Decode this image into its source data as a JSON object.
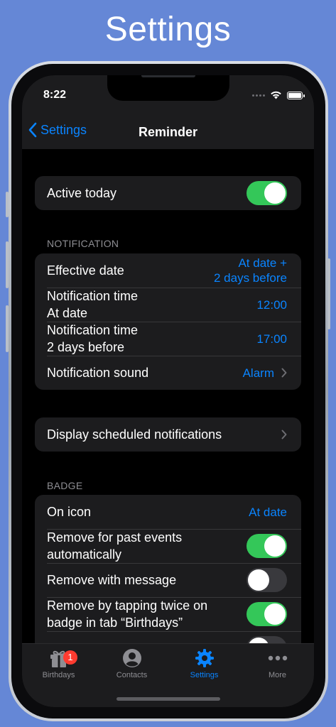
{
  "promo": {
    "title": "Settings"
  },
  "status_bar": {
    "time": "8:22"
  },
  "nav": {
    "back_label": "Settings",
    "title": "Reminder"
  },
  "active_today": {
    "label": "Active today",
    "on": true
  },
  "notification": {
    "header": "NOTIFICATION",
    "rows": [
      {
        "label": "Effective date",
        "value_line1": "At date +",
        "value_line2": "2 days before"
      },
      {
        "label_line1": "Notification time",
        "label_line2": "At date",
        "value": "12:00"
      },
      {
        "label_line1": "Notification time",
        "label_line2": "2 days before",
        "value": "17:00"
      },
      {
        "label": "Notification sound",
        "value": "Alarm"
      }
    ]
  },
  "scheduled": {
    "label": "Display scheduled notifications"
  },
  "badge_section": {
    "header": "BADGE",
    "rows": [
      {
        "label": "On icon",
        "value": "At date"
      },
      {
        "label_line1": "Remove for past events",
        "label_line2": "automatically",
        "on": true
      },
      {
        "label": "Remove with message",
        "on": false
      },
      {
        "label_line1": "Remove by tapping twice on",
        "label_line2": "badge in tab “Birthdays”",
        "on": true
      }
    ]
  },
  "tabs": [
    {
      "label": "Birthdays",
      "icon": "gift-icon",
      "badge": "1",
      "active": false
    },
    {
      "label": "Contacts",
      "icon": "person-circle-icon",
      "active": false
    },
    {
      "label": "Settings",
      "icon": "gear-icon",
      "active": true
    },
    {
      "label": "More",
      "icon": "ellipsis-icon",
      "active": false
    }
  ],
  "colors": {
    "accent": "#0a84ff",
    "toggle_on": "#34c759",
    "background": "#6587d6",
    "badge": "#ff3b30"
  }
}
